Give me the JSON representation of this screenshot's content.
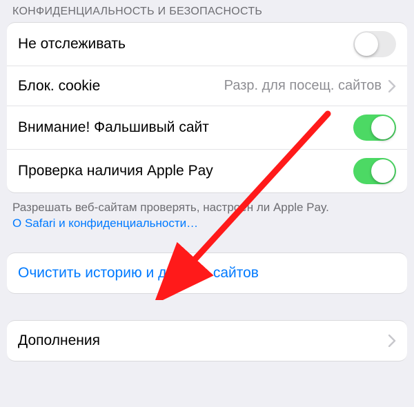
{
  "section_header": "КОНФИДЕНЦИАЛЬНОСТЬ И БЕЗОПАСНОСТЬ",
  "rows": {
    "do_not_track": {
      "label": "Не отслеживать",
      "on": false
    },
    "block_cookies": {
      "label": "Блок. cookie",
      "value": "Разр. для посещ. сайтов"
    },
    "fraud_warning": {
      "label": "Внимание! Фальшивый сайт",
      "on": true
    },
    "apple_pay_check": {
      "label": "Проверка наличия Apple Pay",
      "on": true
    }
  },
  "footer": {
    "text": "Разрешать веб-сайтам проверять, настроен ли Apple Pay.",
    "link": "О Safari и конфиденциальности…"
  },
  "clear_action": "Очистить историю и данные сайтов",
  "extensions": {
    "label": "Дополнения"
  }
}
